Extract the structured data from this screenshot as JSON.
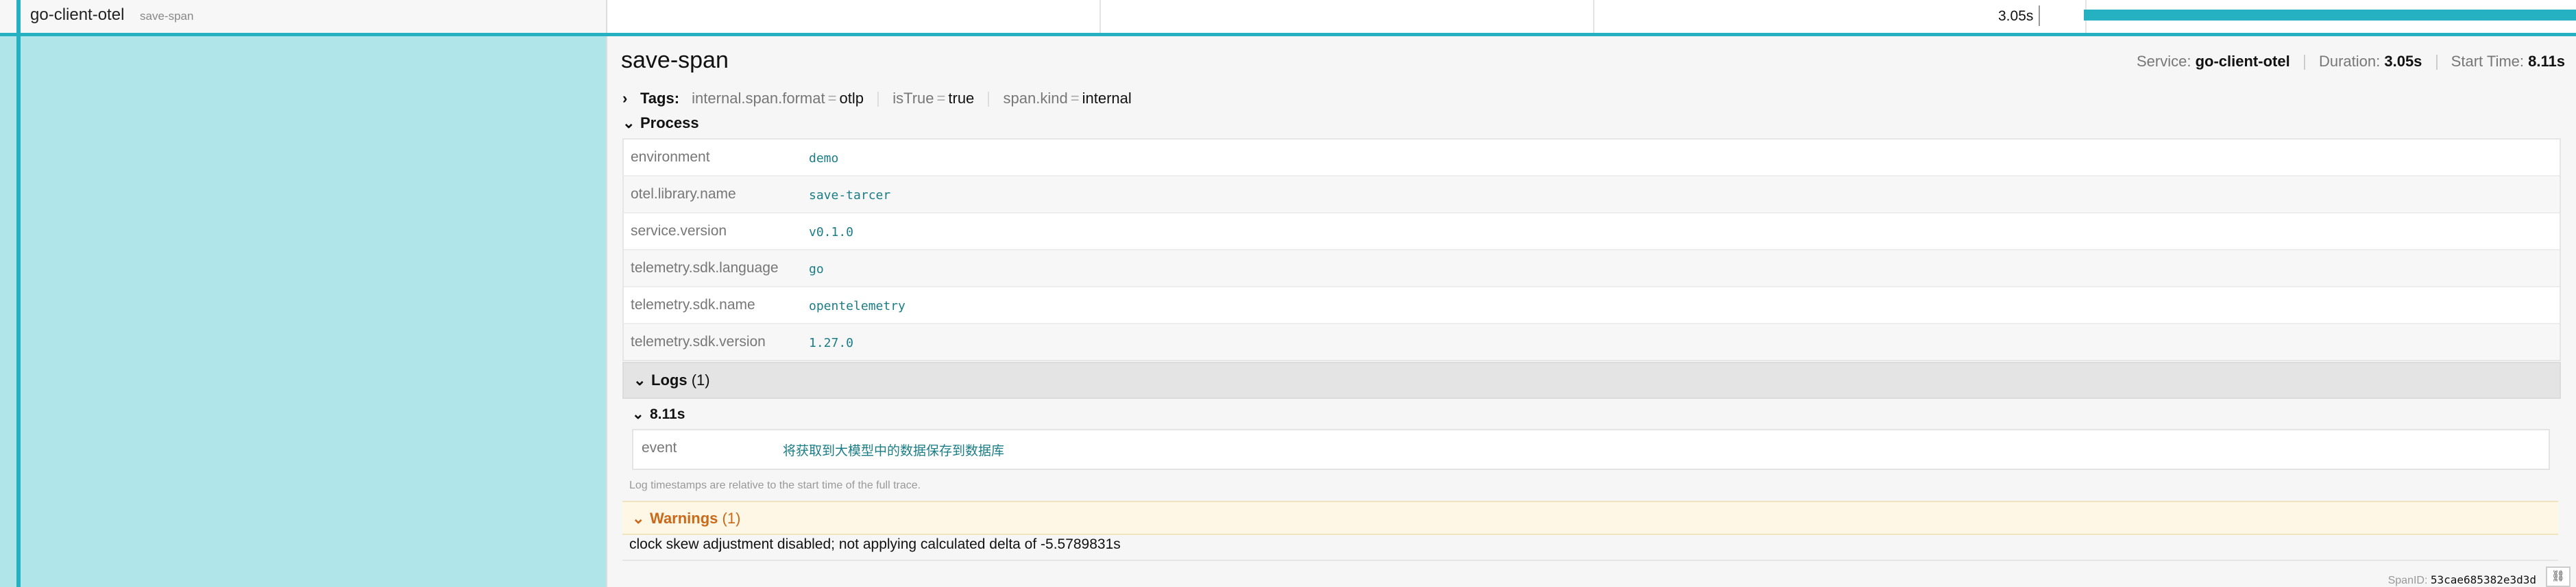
{
  "row": {
    "service": "go-client-otel",
    "operation": "save-span",
    "duration_label": "3.05s"
  },
  "span": {
    "title": "save-span",
    "service_label": "Service:",
    "service": "go-client-otel",
    "duration_label": "Duration:",
    "duration": "3.05s",
    "start_label": "Start Time:",
    "start": "8.11s"
  },
  "tags": {
    "label": "Tags:",
    "items": [
      {
        "key": "internal.span.format",
        "value": "otlp"
      },
      {
        "key": "isTrue",
        "value": "true"
      },
      {
        "key": "span.kind",
        "value": "internal"
      }
    ]
  },
  "process": {
    "label": "Process",
    "items": [
      {
        "key": "environment",
        "value": "demo"
      },
      {
        "key": "otel.library.name",
        "value": "save-tarcer"
      },
      {
        "key": "service.version",
        "value": "v0.1.0"
      },
      {
        "key": "telemetry.sdk.language",
        "value": "go"
      },
      {
        "key": "telemetry.sdk.name",
        "value": "opentelemetry"
      },
      {
        "key": "telemetry.sdk.version",
        "value": "1.27.0"
      }
    ]
  },
  "logs": {
    "label": "Logs",
    "count": "(1)",
    "entry": {
      "timestamp": "8.11s",
      "key": "event",
      "value": "将获取到大模型中的数据保存到数据库"
    },
    "note": "Log timestamps are relative to the start time of the full trace."
  },
  "warnings": {
    "label": "Warnings",
    "count": "(1)",
    "text": "clock skew adjustment disabled; not applying calculated delta of -5.5789831s"
  },
  "footer": {
    "span_id_label": "SpanID:",
    "span_id": "53cae685382e3d3d",
    "link_icon": "link-icon"
  },
  "colors": {
    "accent": "#25b1c1",
    "bar_fill": "#b0e6e9",
    "warning": "#c9691a"
  },
  "duration_bar": {
    "start_fraction": 0.5,
    "width_fraction": 0.5
  }
}
